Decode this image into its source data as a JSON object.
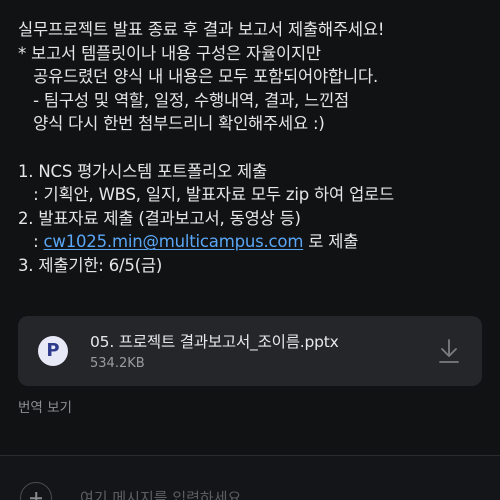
{
  "message": {
    "lines": [
      "실무프로젝트 발표 종료 후 결과 보고서 제출해주세요!",
      "* 보고서 템플릿이나 내용 구성은 자율이지만",
      "   공유드렸던 양식 내 내용은 모두 포함되어야합니다.",
      "   - 팀구성 및 역할, 일정, 수행내역, 결과, 느낀점",
      "   양식 다시 한번 첨부드리니 확인해주세요 :)",
      "",
      "1. NCS 평가시스템 포트폴리오 제출",
      "   : 기획안, WBS, 일지, 발표자료 모두 zip 하여 업로드",
      "2. 발표자료 제출 (결과보고서, 동영상 등)"
    ],
    "email_prefix": "   : ",
    "email": "cw1025.min@multicampus.com",
    "email_suffix": " 로 제출",
    "deadline": "3. 제출기한: 6/5(금)"
  },
  "attachment": {
    "icon_letter": "P",
    "icon": "presentation-file-icon",
    "file_name": "05. 프로젝트 결과보고서_조이름.pptx",
    "file_size": "534.2KB",
    "download_icon": "download-icon"
  },
  "translate_label": "번역 보기",
  "compose": {
    "placeholder": "여기 메시지를 입력하세요"
  },
  "colors": {
    "background": "#111214",
    "link": "#5aa6f5",
    "attachment_bg": "#25262a"
  }
}
